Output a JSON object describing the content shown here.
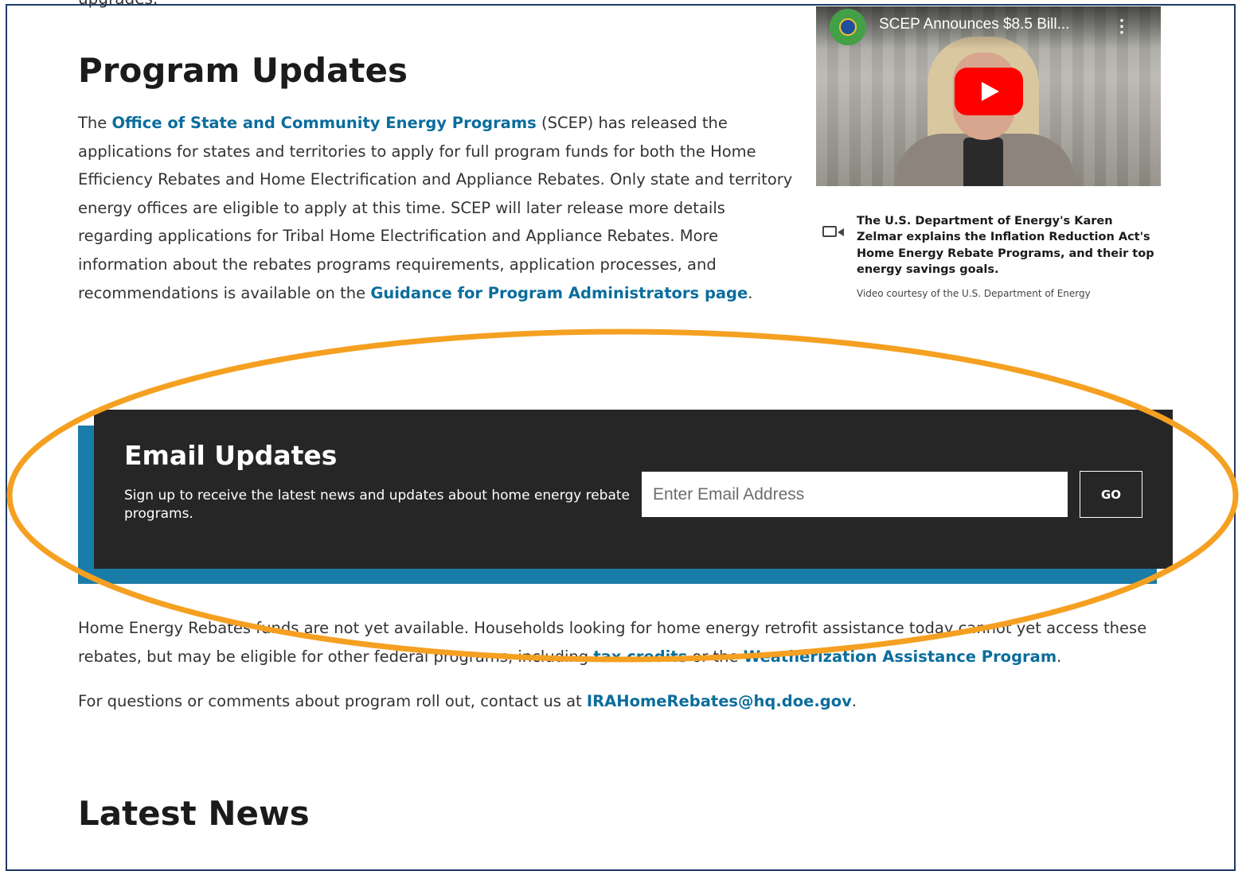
{
  "page": {
    "cut_text": "upgrades."
  },
  "program_updates": {
    "title": "Program Updates",
    "intro_lead": "The ",
    "scep_link": "Office of State and Community Energy Programs",
    "intro_body": " (SCEP) has released the applications for states and territories to apply for full program funds for both the Home Efficiency Rebates and Home Electrification and Appliance Rebates. Only state and territory energy offices are eligible to apply at this time. SCEP will later release more details regarding applications for Tribal Home Electrification and Appliance Rebates. More information about the rebates programs requirements, application processes, and recommendations is available on the ",
    "guidance_link": "Guidance for Program Administrators page",
    "intro_end": "."
  },
  "video": {
    "title": "SCEP Announces $8.5 Bill...",
    "more_icon": "⋮",
    "channel_icon": "doe-seal-icon",
    "play_icon": "youtube-play-icon",
    "caption": "The U.S. Department of Energy's Karen Zelmar explains the Inflation Reduction Act's Home Energy Rebate Programs, and their top energy savings goals.",
    "credit": "Video courtesy of the U.S. Department of Energy",
    "caption_icon": "video-camera-icon"
  },
  "email_updates": {
    "title": "Email Updates",
    "description": "Sign up to receive the latest news and updates about home energy rebate programs.",
    "input_placeholder": "Enter Email Address",
    "input_value": "",
    "button_label": "GO"
  },
  "funds_note": {
    "text_a": "Home Energy Rebates funds are not yet available. Households looking for home energy retrofit assistance today cannot yet access these rebates, but may be eligible for other federal programs, including ",
    "tax_link": "tax credits",
    "text_b": " or the ",
    "wap_link": "Weatherization Assistance Program",
    "text_c": "."
  },
  "contact": {
    "text_a": "For questions or comments about program roll out, contact us at ",
    "email_link": "IRAHomeRebates@hq.doe.gov",
    "text_b": "."
  },
  "latest_news": {
    "title": "Latest News"
  },
  "colors": {
    "link": "#0b6d9c",
    "band_dark": "#262626",
    "band_accent": "#1a7ca8",
    "annotation_ellipse": "#f5a021",
    "frame_border": "#1f3a68"
  }
}
